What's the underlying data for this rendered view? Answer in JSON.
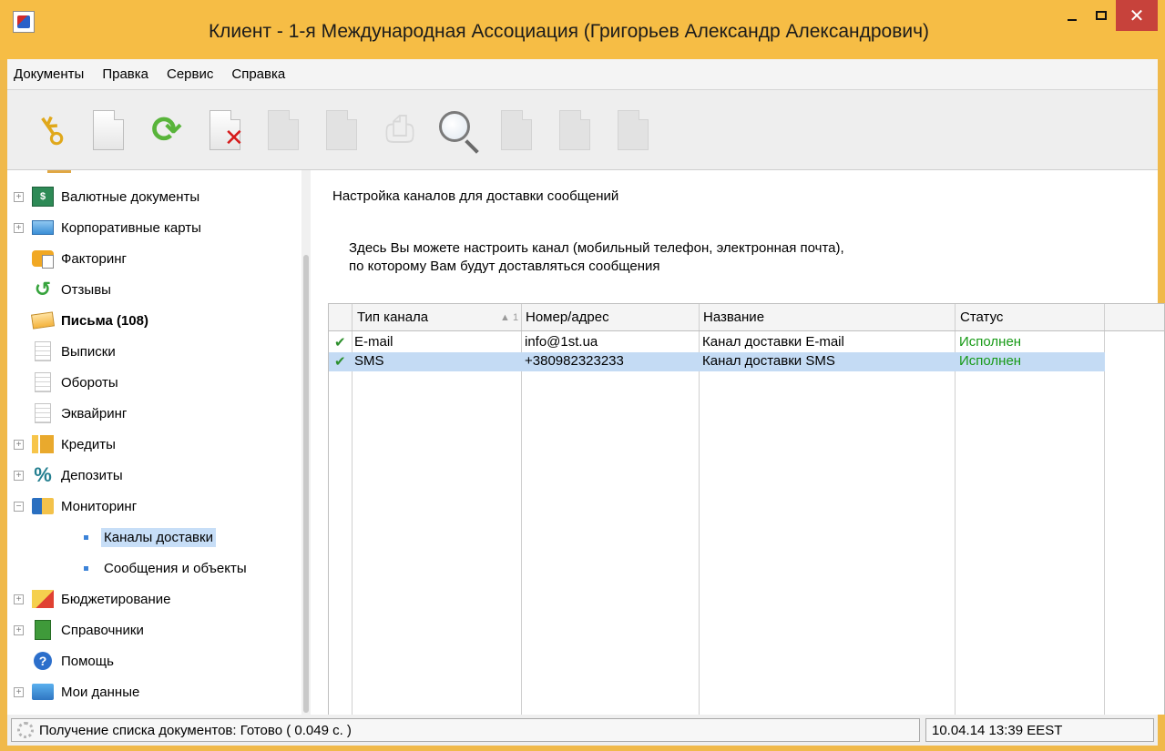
{
  "window": {
    "title": "Клиент - 1-я Международная Ассоциация (Григорьев Александр Александрович)",
    "close_glyph": "✕"
  },
  "menu": [
    "Документы",
    "Правка",
    "Сервис",
    "Справка"
  ],
  "toolbar": {
    "icons": [
      "key-icon",
      "new-document-icon",
      "refresh-icon",
      "delete-icon",
      "edit-icon",
      "copy-icon",
      "print-icon",
      "search-icon",
      "import-icon",
      "export-icon",
      "sign-icon"
    ]
  },
  "tree": {
    "items": [
      {
        "label": "Валютные документы",
        "icon": "currency-docs-icon",
        "expandable": true
      },
      {
        "label": "Корпоративные карты",
        "icon": "corporate-card-icon",
        "expandable": true
      },
      {
        "label": "Факторинг",
        "icon": "factoring-icon",
        "expandable": false
      },
      {
        "label": "Отзывы",
        "icon": "recall-icon",
        "expandable": false
      },
      {
        "label": "Письма (108)",
        "icon": "envelope-icon",
        "expandable": false,
        "bold": true
      },
      {
        "label": "Выписки",
        "icon": "statement-icon",
        "expandable": false
      },
      {
        "label": "Обороты",
        "icon": "turnover-icon",
        "expandable": false
      },
      {
        "label": "Эквайринг",
        "icon": "acquiring-icon",
        "expandable": false
      },
      {
        "label": "Кредиты",
        "icon": "credit-icon",
        "expandable": true
      },
      {
        "label": "Депозиты",
        "icon": "percent-icon",
        "expandable": true
      },
      {
        "label": "Мониторинг",
        "icon": "monitoring-icon",
        "expandable": true,
        "expanded": true
      },
      {
        "label": "Каналы доставки",
        "icon": "bullet-icon",
        "child": true,
        "selected": true
      },
      {
        "label": "Сообщения и объекты",
        "icon": "bullet-icon",
        "child": true
      },
      {
        "label": "Бюджетирование",
        "icon": "budget-chart-icon",
        "expandable": true
      },
      {
        "label": "Справочники",
        "icon": "reference-book-icon",
        "expandable": true
      },
      {
        "label": "Помощь",
        "icon": "help-icon",
        "expandable": false
      },
      {
        "label": "Мои данные",
        "icon": "folder-icon",
        "expandable": true
      }
    ],
    "expand_glyph": "+",
    "collapse_glyph": "−"
  },
  "content": {
    "title": "Настройка каналов для доставки сообщений",
    "description_line1": "Здесь Вы можете настроить канал (мобильный телефон, электронная почта),",
    "description_line2": "по которому Вам будут доставляться сообщения"
  },
  "grid": {
    "columns": [
      "Тип канала",
      "Номер/адрес",
      "Название",
      "Статус"
    ],
    "sort_indicator": "▲ 1",
    "rows": [
      {
        "check": "✔",
        "type": "E-mail",
        "address": "info@1st.ua",
        "name": "Канал доставки E-mail",
        "status": "Исполнен"
      },
      {
        "check": "✔",
        "type": "SMS",
        "address": "+380982323233",
        "name": "Канал доставки SMS",
        "status": "Исполнен"
      }
    ]
  },
  "status": {
    "left": "Получение списка документов: Готово ( 0.049 с. )",
    "right": "10.04.14 13:39 EEST"
  },
  "colors": {
    "titlebar": "#f6bd45",
    "close_button": "#c7423b",
    "selection": "#c4dbf4",
    "status_ok": "#179a17"
  }
}
